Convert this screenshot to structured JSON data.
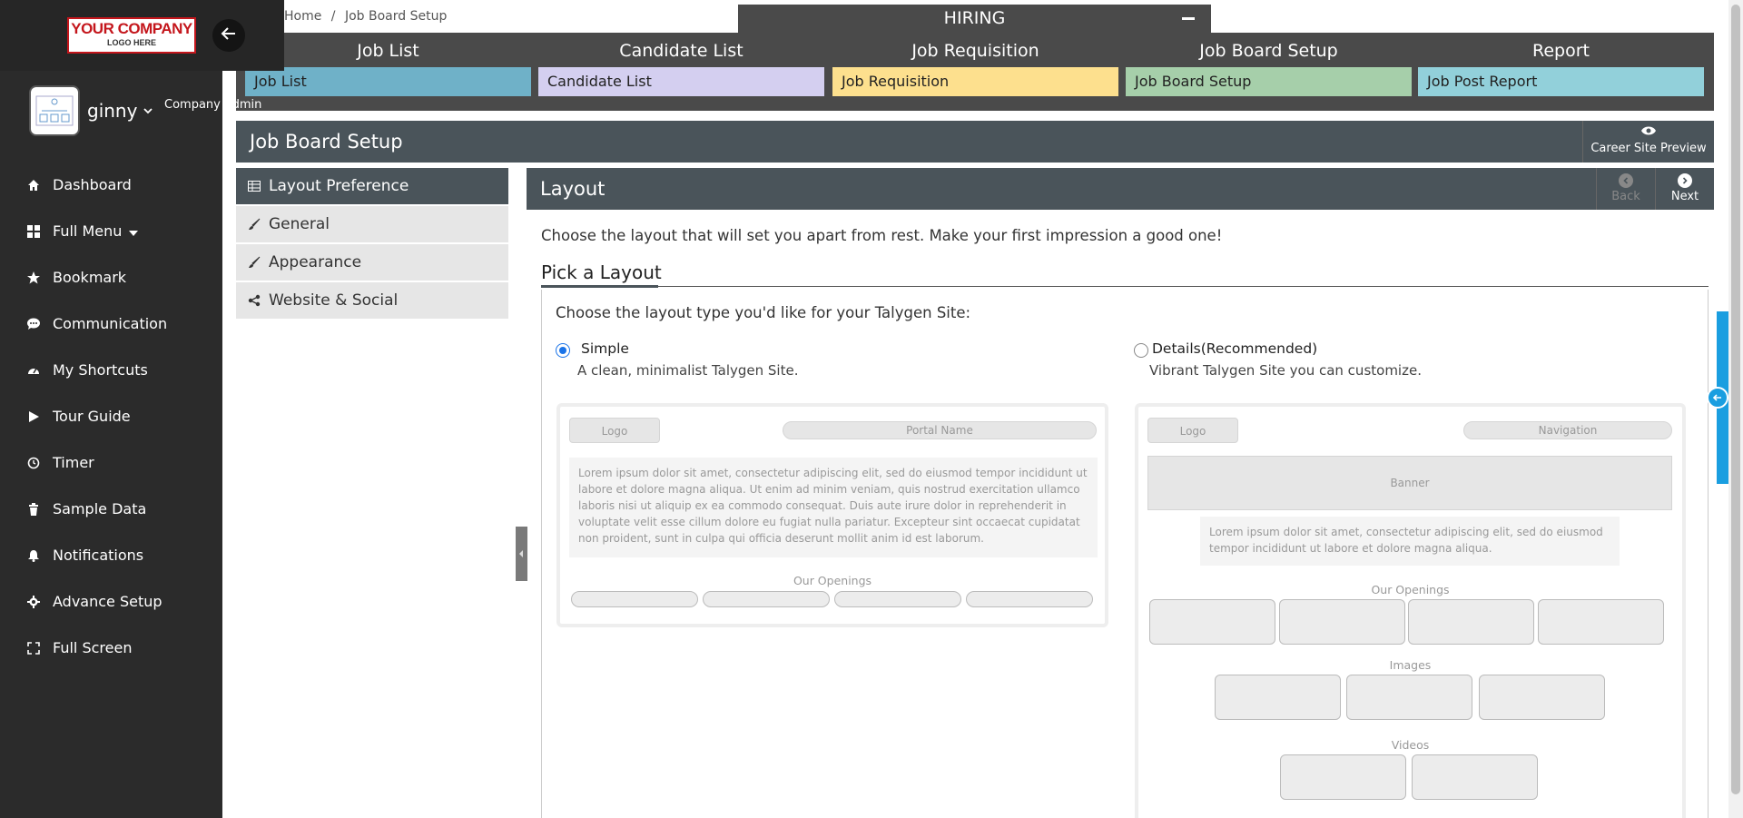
{
  "sidebar": {
    "logo_line1": "YOUR COMPANY",
    "logo_line2": "LOGO HERE",
    "user_name": "ginny",
    "user_role": "Company Admin",
    "items": [
      {
        "label": "Dashboard",
        "icon": "home-icon"
      },
      {
        "label": "Full Menu",
        "icon": "grid-icon"
      },
      {
        "label": "Bookmark",
        "icon": "star-icon"
      },
      {
        "label": "Communication",
        "icon": "chat-icon"
      },
      {
        "label": "My Shortcuts",
        "icon": "speedometer-icon"
      },
      {
        "label": "Tour Guide",
        "icon": "play-icon"
      },
      {
        "label": "Timer",
        "icon": "clock-icon"
      },
      {
        "label": "Sample Data",
        "icon": "trash-icon"
      },
      {
        "label": "Notifications",
        "icon": "bell-icon"
      },
      {
        "label": "Advance Setup",
        "icon": "gear-icon"
      },
      {
        "label": "Full Screen",
        "icon": "expand-icon"
      }
    ]
  },
  "breadcrumb": {
    "home": "Home",
    "current": "Job Board Setup"
  },
  "hiring_tab": "HIRING",
  "modules": [
    {
      "title": "Job List",
      "link": "Job List",
      "color": "#6fb1c8"
    },
    {
      "title": "Candidate List",
      "link": "Candidate List",
      "color": "#d4cff0"
    },
    {
      "title": "Job Requisition",
      "link": "Job Requisition",
      "color": "#fde08e"
    },
    {
      "title": "Job Board Setup",
      "link": "Job Board Setup",
      "color": "#a6cfaa"
    },
    {
      "title": "Report",
      "link": "Job Post Report",
      "color": "#92d0da"
    }
  ],
  "page_title": "Job Board Setup",
  "career_site_preview": "Career Site Preview",
  "settings_menu": [
    {
      "label": "Layout Preference",
      "icon": "table-icon"
    },
    {
      "label": "General",
      "icon": "brush-icon"
    },
    {
      "label": "Appearance",
      "icon": "brush-icon"
    },
    {
      "label": "Website & Social",
      "icon": "share-icon"
    }
  ],
  "layout": {
    "title": "Layout",
    "back": "Back",
    "next": "Next",
    "intro": "Choose the layout that will set you apart from rest. Make your first impression a good one!",
    "pick_title": "Pick a Layout",
    "choose_label": "Choose the layout type you'd like for your Talygen Site:",
    "options": [
      {
        "title": "Simple",
        "desc": "A clean, minimalist Talygen Site.",
        "selected": true
      },
      {
        "title": "Details(Recommended)",
        "desc": "Vibrant Talygen Site you can customize.",
        "selected": false
      }
    ],
    "simple_preview": {
      "logo": "Logo",
      "portal_name": "Portal Name",
      "lorem": "Lorem ipsum dolor sit amet, consectetur adipiscing elit, sed do eiusmod tempor incididunt ut labore et dolore magna aliqua. Ut enim ad minim veniam, quis nostrud exercitation ullamco laboris nisi ut aliquip ex ea commodo consequat. Duis aute irure dolor in reprehenderit in voluptate velit esse cillum dolore eu fugiat nulla pariatur. Excepteur sint occaecat cupidatat non proident, sunt in culpa qui officia deserunt mollit anim id est laborum.",
      "openings": "Our Openings"
    },
    "details_preview": {
      "logo": "Logo",
      "navigation": "Navigation",
      "banner": "Banner",
      "lorem": "Lorem ipsum dolor sit amet, consectetur adipiscing elit, sed do eiusmod tempor incididunt ut labore et dolore magna aliqua.",
      "openings": "Our Openings",
      "images": "Images",
      "videos": "Videos"
    }
  }
}
